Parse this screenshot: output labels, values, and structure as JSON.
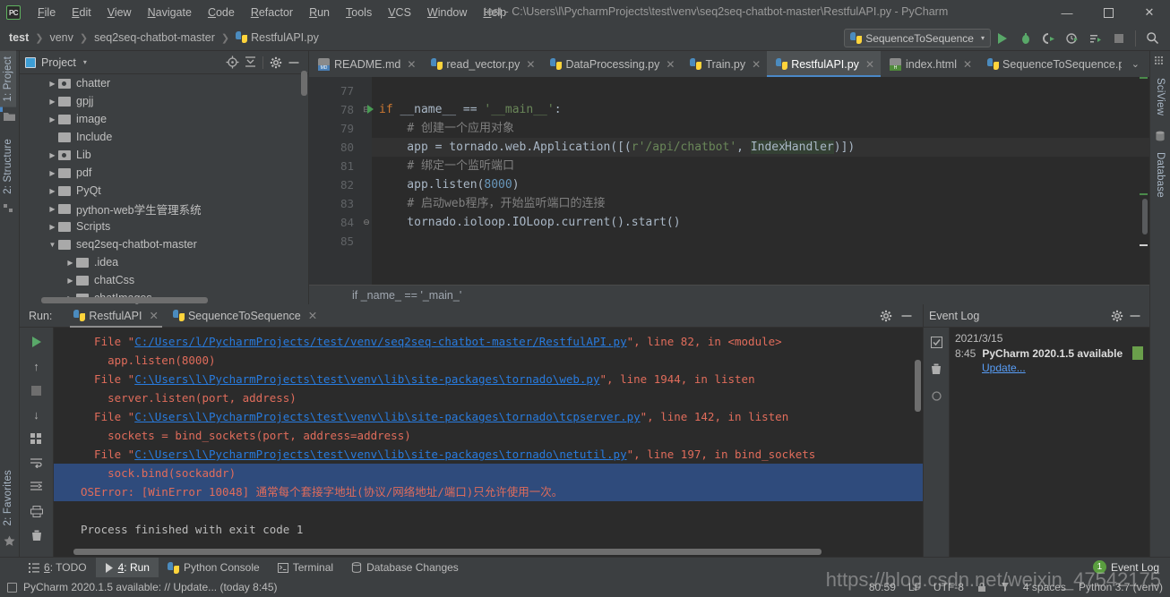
{
  "window": {
    "app_badge": "PC",
    "title": "test - C:\\Users\\l\\PycharmProjects\\test\\venv\\seq2seq-chatbot-master\\RestfulAPI.py - PyCharm",
    "minimize": "—",
    "maximize": "☐",
    "close": "✕"
  },
  "menubar": {
    "items": [
      "File",
      "Edit",
      "View",
      "Navigate",
      "Code",
      "Refactor",
      "Run",
      "Tools",
      "VCS",
      "Window",
      "Help"
    ]
  },
  "breadcrumb": {
    "items": [
      "test",
      "venv",
      "seq2seq-chatbot-master",
      "RestfulAPI.py"
    ]
  },
  "toolbar": {
    "run_config": "SequenceToSequence",
    "caret": "▾",
    "icons": [
      "run-icon",
      "debug-icon",
      "run-coverage-icon",
      "profile-icon",
      "run-with-params-icon",
      "stop-icon",
      "search-everywhere-icon"
    ]
  },
  "left_strip": {
    "tabs": [
      {
        "label": "1: Project",
        "underline": "1",
        "active": true
      },
      {
        "label": "2: Structure",
        "underline": "2",
        "active": false
      },
      {
        "label": "2: Favorites",
        "underline": "2",
        "active": false
      }
    ]
  },
  "right_strip": {
    "tabs": [
      "SciView",
      "Database"
    ]
  },
  "project_panel": {
    "title": "Project",
    "header_icons": [
      "locate-icon",
      "collapse-all-icon",
      "gear-icon",
      "hide-icon"
    ],
    "tree": [
      {
        "label": "chatter",
        "indent": 1,
        "arrow": "▶",
        "type": "source-folder"
      },
      {
        "label": "gpjj",
        "indent": 1,
        "arrow": "▶",
        "type": "folder"
      },
      {
        "label": "image",
        "indent": 1,
        "arrow": "▶",
        "type": "folder"
      },
      {
        "label": "Include",
        "indent": 1,
        "arrow": "",
        "type": "folder"
      },
      {
        "label": "Lib",
        "indent": 1,
        "arrow": "▶",
        "type": "source-folder"
      },
      {
        "label": "pdf",
        "indent": 1,
        "arrow": "▶",
        "type": "folder"
      },
      {
        "label": "PyQt",
        "indent": 1,
        "arrow": "▶",
        "type": "folder"
      },
      {
        "label": "python-web学生管理系统",
        "indent": 1,
        "arrow": "▶",
        "type": "folder"
      },
      {
        "label": "Scripts",
        "indent": 1,
        "arrow": "▶",
        "type": "folder"
      },
      {
        "label": "seq2seq-chatbot-master",
        "indent": 1,
        "arrow": "▼",
        "type": "folder"
      },
      {
        "label": ".idea",
        "indent": 2,
        "arrow": "▶",
        "type": "folder"
      },
      {
        "label": "chatCss",
        "indent": 2,
        "arrow": "▶",
        "type": "folder"
      },
      {
        "label": "chatImages",
        "indent": 2,
        "arrow": "▶",
        "type": "folder"
      }
    ]
  },
  "editor": {
    "tabs": [
      {
        "label": "README.md",
        "icon": "markdown-icon",
        "active": false
      },
      {
        "label": "read_vector.py",
        "icon": "python-icon",
        "active": false
      },
      {
        "label": "DataProcessing.py",
        "icon": "python-icon",
        "active": false
      },
      {
        "label": "Train.py",
        "icon": "python-icon",
        "active": false
      },
      {
        "label": "RestfulAPI.py",
        "icon": "python-icon",
        "active": true
      },
      {
        "label": "index.html",
        "icon": "html-icon",
        "active": false
      },
      {
        "label": "SequenceToSequence.p",
        "icon": "python-icon",
        "active": false
      }
    ],
    "tab_overflow": "⌄",
    "lines": [
      {
        "n": "77",
        "html": ""
      },
      {
        "n": "78",
        "html": "<span class=\"kw\">if</span> __name__ == <span class=\"str\">'__main__'</span>:",
        "runmark": true,
        "fold": "⊟"
      },
      {
        "n": "79",
        "html": "    <span class=\"cmt\"># 创建一个应用对象</span>"
      },
      {
        "n": "80",
        "html": "    app = tornado.web.Application([(<span class=\"str\">r'/api/chatbot'</span>, <span class=\"sel\">Index</span><span class=\"caret-blink\"></span><span class=\"sel\">Handler</span>)])",
        "current": true
      },
      {
        "n": "81",
        "html": "    <span class=\"cmt\"># 绑定一个监听端口</span>"
      },
      {
        "n": "82",
        "html": "    app.listen(<span class=\"num\">8000</span>)"
      },
      {
        "n": "83",
        "html": "    <span class=\"cmt\"># 启动web程序，开始监听端口的连接</span>"
      },
      {
        "n": "84",
        "html": "    tornado.ioloop.IOLoop.current().start()",
        "fold": "⊖"
      },
      {
        "n": "85",
        "html": ""
      }
    ],
    "structure_breadcrumb": "if _name_ == '_main_'"
  },
  "run_panel": {
    "label": "Run:",
    "tabs": [
      {
        "label": "RestfulAPI",
        "active": true
      },
      {
        "label": "SequenceToSequence",
        "active": false
      }
    ],
    "toolbar_icons": [
      "rerun-icon",
      "scroll-up-icon",
      "stop-icon",
      "scroll-down-icon",
      "print-grid-icon",
      "soft-wrap-icon",
      "scroll-to-end-icon",
      "print-icon",
      "clear-all-icon"
    ],
    "console_lines": [
      {
        "segs": [
          {
            "t": "  File \"",
            "c": "err"
          },
          {
            "t": "C:/Users/l/PycharmProjects/test/venv/seq2seq-chatbot-master/RestfulAPI.py",
            "c": "lnk"
          },
          {
            "t": "\", line 82, in <module>",
            "c": "err"
          }
        ]
      },
      {
        "segs": [
          {
            "t": "    app.listen(8000)",
            "c": "err"
          }
        ]
      },
      {
        "segs": [
          {
            "t": "  File \"",
            "c": "err"
          },
          {
            "t": "C:\\Users\\l\\PycharmProjects\\test\\venv\\lib\\site-packages\\tornado\\web.py",
            "c": "lnk"
          },
          {
            "t": "\", line 1944, in listen",
            "c": "err"
          }
        ]
      },
      {
        "segs": [
          {
            "t": "    server.listen(port, address)",
            "c": "err"
          }
        ]
      },
      {
        "segs": [
          {
            "t": "  File \"",
            "c": "err"
          },
          {
            "t": "C:\\Users\\l\\PycharmProjects\\test\\venv\\lib\\site-packages\\tornado\\tcpserver.py",
            "c": "lnk"
          },
          {
            "t": "\", line 142, in listen",
            "c": "err"
          }
        ]
      },
      {
        "segs": [
          {
            "t": "    sockets = bind_sockets(port, address=address)",
            "c": "err"
          }
        ]
      },
      {
        "segs": [
          {
            "t": "  File \"",
            "c": "err"
          },
          {
            "t": "C:\\Users\\l\\PycharmProjects\\test\\venv\\lib\\site-packages\\tornado\\netutil.py",
            "c": "lnk"
          },
          {
            "t": "\", line 197, in bind_sockets",
            "c": "err"
          }
        ]
      },
      {
        "selected": true,
        "segs": [
          {
            "t": "    sock.bind(sockaddr)",
            "c": "err"
          }
        ]
      },
      {
        "selected": true,
        "segs": [
          {
            "t": "OSError: [WinError 10048] 通常每个套接字地址(协议/网络地址/端口)只允许使用一次。",
            "c": "err"
          }
        ]
      },
      {
        "segs": [
          {
            "t": "",
            "c": "err"
          }
        ]
      },
      {
        "plain": true,
        "segs": [
          {
            "t": "Process finished with exit code 1",
            "c": "plain"
          }
        ]
      }
    ]
  },
  "event_log": {
    "title": "Event Log",
    "header_icons": [
      "gear-icon",
      "hide-icon"
    ],
    "toolbar_icons": [
      "mark-read-icon",
      "delete-icon",
      "settings-icon"
    ],
    "date": "2021/3/15",
    "time": "8:45",
    "message": "PyCharm 2020.1.5 available",
    "link": "Update..."
  },
  "toolwindow_bar": {
    "items": [
      {
        "label": "6: TODO",
        "underline": "6",
        "icon": "todo-icon",
        "active": false
      },
      {
        "label": "4: Run",
        "underline": "4",
        "icon": "run-icon",
        "active": true
      },
      {
        "label": "Python Console",
        "icon": "python-icon",
        "active": false
      },
      {
        "label": "Terminal",
        "icon": "terminal-icon",
        "active": false
      },
      {
        "label": "Database Changes",
        "icon": "database-icon",
        "active": false
      }
    ]
  },
  "statusbar": {
    "message": "PyCharm 2020.1.5 available: // Update... (today 8:45)",
    "position": "80:59",
    "line_sep": "LF",
    "encoding": "UTF-8",
    "indent": "4 spaces",
    "interpreter": "Python 3.7 (venv)"
  },
  "event_log_badge": {
    "count": "1",
    "label": "Event Log"
  },
  "watermark": "https://blog.csdn.net/weixin_47542175",
  "colors": {
    "bg": "#3c3f41",
    "editor_bg": "#2b2b2b",
    "accent": "#4a88c7",
    "error": "#cf6a4c",
    "link": "#287bde",
    "selection": "#2f4b7c",
    "green": "#59a869"
  }
}
